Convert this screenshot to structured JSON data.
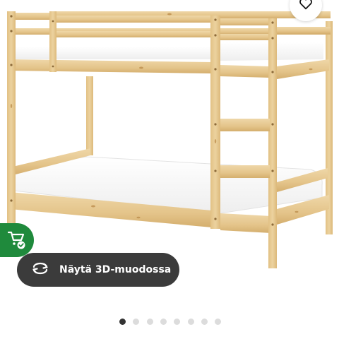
{
  "product": {
    "image_name": "bunk-bed-frame-pine"
  },
  "favorite": {
    "icon": "heart-icon"
  },
  "eco_badge": {
    "icon": "eco-cart-check-icon",
    "color": "#1f8a3c"
  },
  "view_3d": {
    "label": "Näytä 3D-muodossa",
    "icon": "rotate-3d-icon",
    "background": "#3b3b3b"
  },
  "carousel": {
    "total": 8,
    "active_index": 0,
    "active_color": "#333333",
    "inactive_color": "#dcdcdc"
  },
  "colors": {
    "wood_light": "#e8cd98",
    "wood_mid": "#dcbb7e",
    "wood_dark": "#c59a57",
    "mattress": "#ffffff"
  }
}
